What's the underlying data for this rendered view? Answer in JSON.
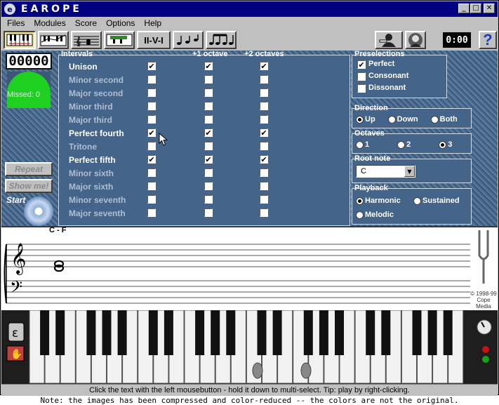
{
  "window": {
    "title": "EAROPE",
    "minimize": "_",
    "maximize": "□",
    "close": "✕"
  },
  "menu": [
    "Files",
    "Modules",
    "Score",
    "Options",
    "Help"
  ],
  "toolbar": {
    "chord_label": "II-V-I",
    "timer": "0:00",
    "help": "?"
  },
  "stats": {
    "score": "00000",
    "missed_label": "Missed:",
    "missed_value": "0"
  },
  "buttons": {
    "repeat": "Repeat",
    "show_me": "Show me!",
    "start": "Start"
  },
  "intervals": {
    "header_label": "Intervals",
    "col_octave1": "+1 octave",
    "col_octave2": "+2 octaves",
    "rows": [
      {
        "name": "Unison",
        "active": true,
        "c0": true,
        "c1": true,
        "c2": true
      },
      {
        "name": "Minor second",
        "active": false,
        "c0": false,
        "c1": false,
        "c2": false
      },
      {
        "name": "Major second",
        "active": false,
        "c0": false,
        "c1": false,
        "c2": false
      },
      {
        "name": "Minor third",
        "active": false,
        "c0": false,
        "c1": false,
        "c2": false
      },
      {
        "name": "Major third",
        "active": false,
        "c0": false,
        "c1": false,
        "c2": false
      },
      {
        "name": "Perfect fourth",
        "active": true,
        "c0": true,
        "c1": true,
        "c2": true
      },
      {
        "name": "Tritone",
        "active": false,
        "c0": false,
        "c1": false,
        "c2": false
      },
      {
        "name": "Perfect fifth",
        "active": true,
        "c0": true,
        "c1": true,
        "c2": true
      },
      {
        "name": "Minor sixth",
        "active": false,
        "c0": false,
        "c1": false,
        "c2": false
      },
      {
        "name": "Major sixth",
        "active": false,
        "c0": false,
        "c1": false,
        "c2": false
      },
      {
        "name": "Minor seventh",
        "active": false,
        "c0": false,
        "c1": false,
        "c2": false
      },
      {
        "name": "Major seventh",
        "active": false,
        "c0": false,
        "c1": false,
        "c2": false
      }
    ]
  },
  "preselections": {
    "label": "Preselections",
    "items": [
      {
        "name": "Perfect",
        "checked": true
      },
      {
        "name": "Consonant",
        "checked": false
      },
      {
        "name": "Dissonant",
        "checked": false
      }
    ]
  },
  "direction": {
    "label": "Direction",
    "options": [
      "Up",
      "Down",
      "Both"
    ],
    "selected": "Up"
  },
  "octaves": {
    "label": "Octaves",
    "options": [
      "1",
      "2",
      "3"
    ],
    "selected": "3"
  },
  "root_note": {
    "label": "Root note",
    "value": "C"
  },
  "playback": {
    "label": "Playback",
    "options": [
      "Harmonic",
      "Sustained",
      "Melodic"
    ],
    "selected": "Harmonic"
  },
  "staff": {
    "interval_label": "C - F",
    "copyright": [
      "© 1998-99",
      "Cope",
      "Media"
    ]
  },
  "status_text": "Click the text with the left mousebutton - hold it down to multi-select. Tip: play by right-clicking.",
  "caption": "Note: the images has been compressed and color-reduced -- the colors are not the original.",
  "colors": {
    "panel": "#44648a",
    "title_bar": "#000080",
    "gauge": "#20d020"
  }
}
